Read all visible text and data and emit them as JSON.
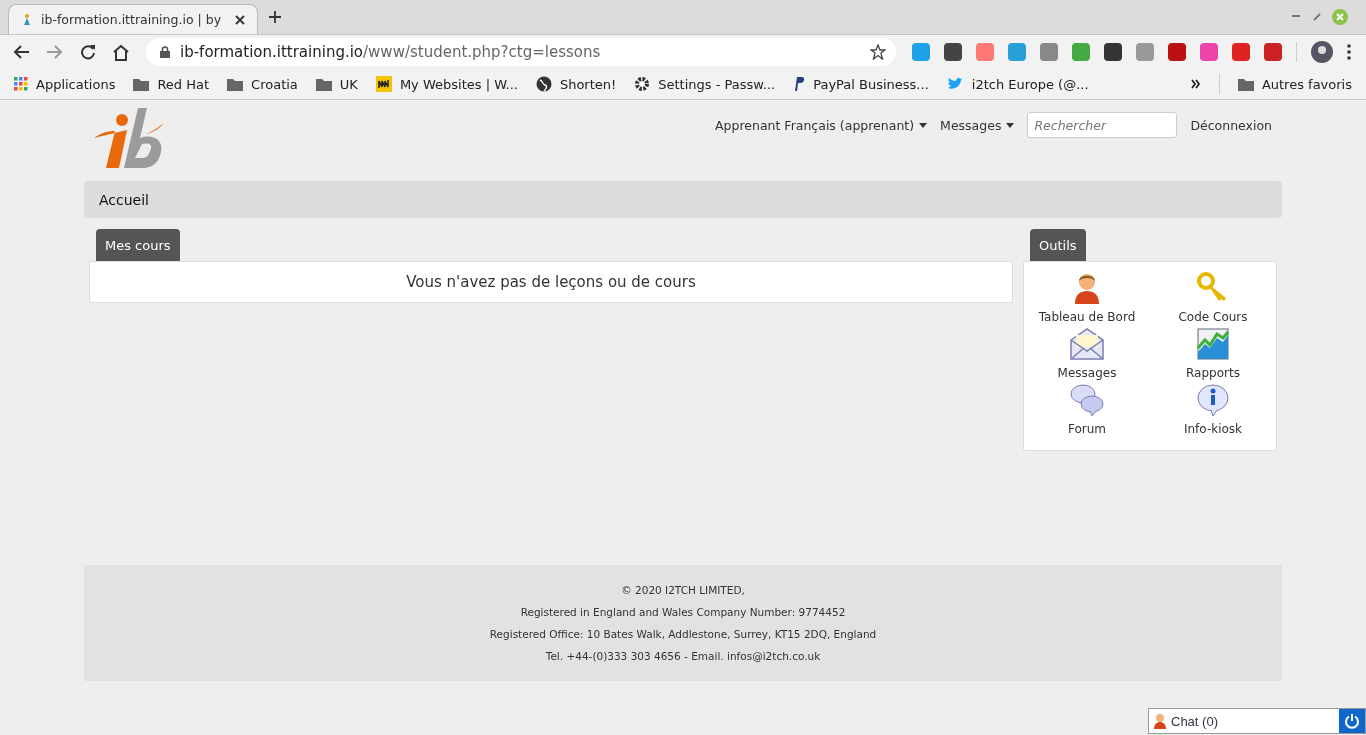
{
  "browser": {
    "tabs": [
      {
        "title": "ib-formation.ittraining.io | by",
        "selected": true
      }
    ],
    "url": {
      "host": "ib-formation.ittraining.io",
      "path": "/www/student.php?ctg=lessons"
    },
    "bookmarks": [
      {
        "label": "Applications",
        "kind": "apps"
      },
      {
        "label": "Red Hat",
        "kind": "folder"
      },
      {
        "label": "Croatia",
        "kind": "folder"
      },
      {
        "label": "UK",
        "kind": "folder"
      },
      {
        "label": "My Websites | W...",
        "kind": "site"
      },
      {
        "label": "Shorten!",
        "kind": "globe"
      },
      {
        "label": "Settings - Passw...",
        "kind": "gear"
      },
      {
        "label": "PayPal Business...",
        "kind": "paypal"
      },
      {
        "label": "i2tch Europe (@...",
        "kind": "bird"
      }
    ],
    "other_bookmarks": "Autres favoris"
  },
  "header": {
    "user_menu": "Apprenant Français (apprenant)",
    "messages_menu": "Messages",
    "search": {
      "placeholder": "Rechercher"
    },
    "logout": "Déconnexion"
  },
  "breadcrumb": "Accueil",
  "courses": {
    "title": "Mes cours",
    "empty_message": "Vous n'avez pas de leçons ou de cours"
  },
  "tools": {
    "title": "Outils",
    "items": [
      {
        "label": "Tableau de Bord",
        "kind": "person"
      },
      {
        "label": "Code Cours",
        "kind": "key"
      },
      {
        "label": "Messages",
        "kind": "envelope"
      },
      {
        "label": "Rapports",
        "kind": "chart"
      },
      {
        "label": "Forum",
        "kind": "bubbles"
      },
      {
        "label": "Info-kiosk",
        "kind": "info"
      }
    ]
  },
  "footer": [
    "© 2020 I2TCH LIMITED,",
    "Registered in England and Wales Company Number: 9774452",
    "Registered Office: 10 Bates Walk, Addlestone, Surrey, KT15 2DQ, England",
    "Tel. +44-(0)333 303 4656 - Email. infos@i2tch.co.uk"
  ],
  "chat": {
    "label": "Chat (0)"
  }
}
